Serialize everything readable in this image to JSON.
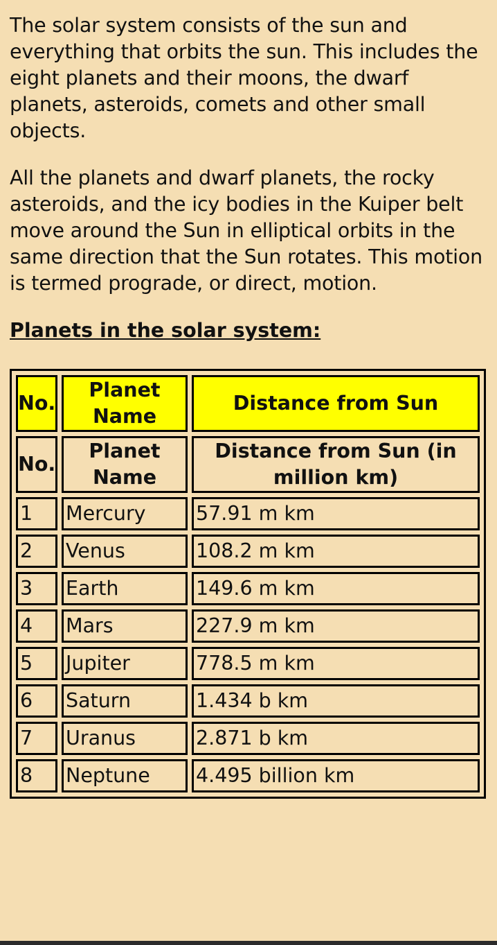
{
  "paragraphs": [
    "The solar system consists of the sun and everything that orbits the sun. This includes the eight planets and their moons, the dwarf planets, asteroids, comets and other small objects.",
    "All the planets and dwarf planets, the rocky asteroids, and the icy bodies in the Kuiper belt move around the Sun in elliptical orbits in the same direction that the Sun rotates. This motion is termed prograde, or direct, motion."
  ],
  "section_title": "Planets in the solar system:",
  "table": {
    "header_yellow": {
      "no": "No.",
      "name": "Planet Name",
      "distance": "Distance from Sun"
    },
    "header_plain": {
      "no": "No.",
      "name": "Planet Name",
      "distance": "Distance from Sun (in million km)"
    },
    "header_color": "#ffff00",
    "rows": [
      {
        "no": "1",
        "name": "Mercury",
        "distance": "57.91 m km"
      },
      {
        "no": "2",
        "name": "Venus",
        "distance": "108.2 m km"
      },
      {
        "no": "3",
        "name": "Earth",
        "distance": "149.6 m km"
      },
      {
        "no": "4",
        "name": "Mars",
        "distance": "227.9 m km"
      },
      {
        "no": "5",
        "name": "Jupiter",
        "distance": "778.5 m km"
      },
      {
        "no": "6",
        "name": "Saturn",
        "distance": "1.434 b km"
      },
      {
        "no": "7",
        "name": "Uranus",
        "distance": "2.871 b km"
      },
      {
        "no": "8",
        "name": "Neptune",
        "distance": "4.495 billion km"
      }
    ]
  },
  "background_color": "#f5deb3"
}
